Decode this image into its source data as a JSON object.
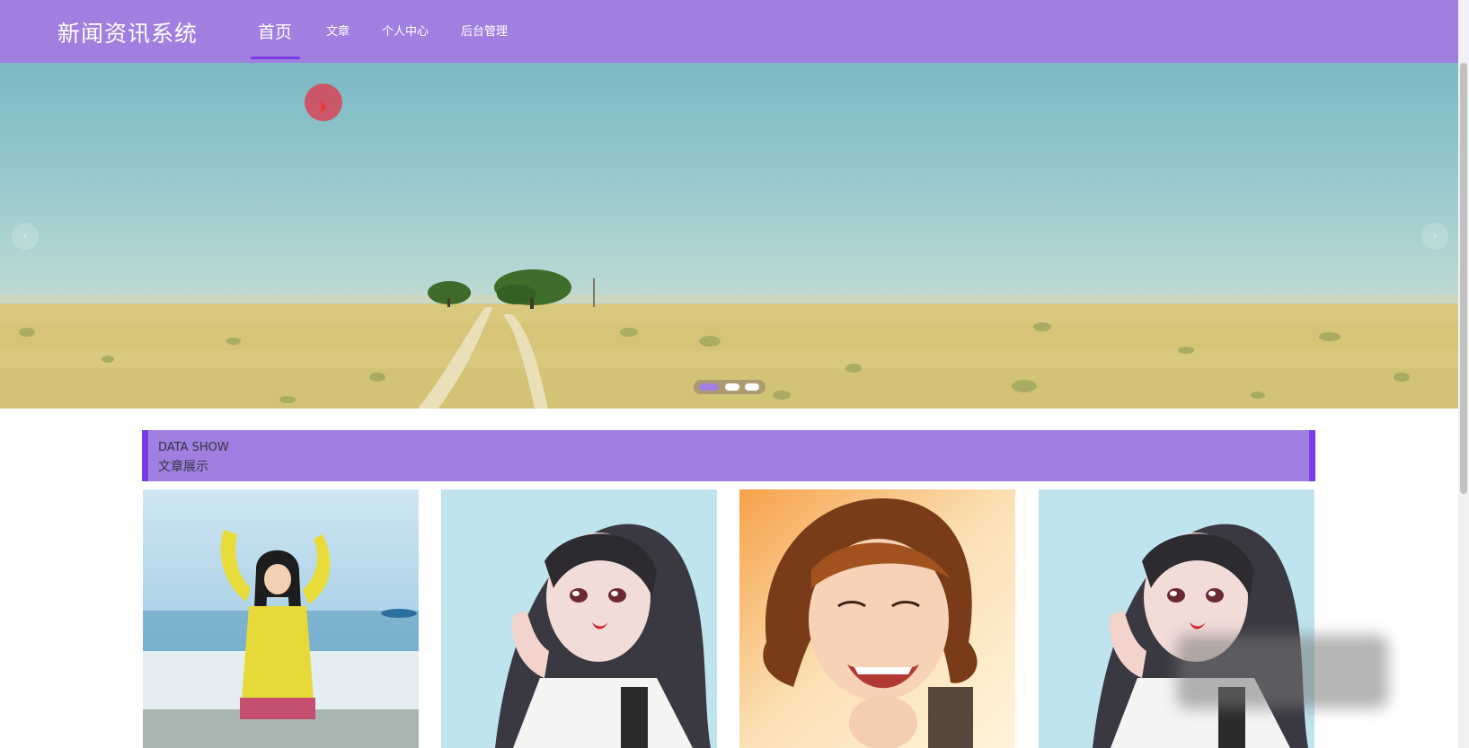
{
  "header": {
    "logo": "新闻资讯系统",
    "nav": [
      {
        "label": "首页",
        "active": true
      },
      {
        "label": "文章",
        "active": false
      },
      {
        "label": "个人中心",
        "active": false
      },
      {
        "label": "后台管理",
        "active": false
      }
    ]
  },
  "carousel": {
    "image": "savanna-landscape",
    "slide_count": 3,
    "active_slide": 1
  },
  "section": {
    "title_en": "DATA SHOW",
    "title_cn": "文章展示"
  },
  "articles": [
    {
      "image": "girl-yellow-sweater-beach"
    },
    {
      "image": "anime-girl-illustration"
    },
    {
      "image": "smiling-girl-portrait"
    },
    {
      "image": "anime-girl-illustration"
    }
  ],
  "colors": {
    "primary": "#a17fe0",
    "accent": "#7b3ae3"
  }
}
